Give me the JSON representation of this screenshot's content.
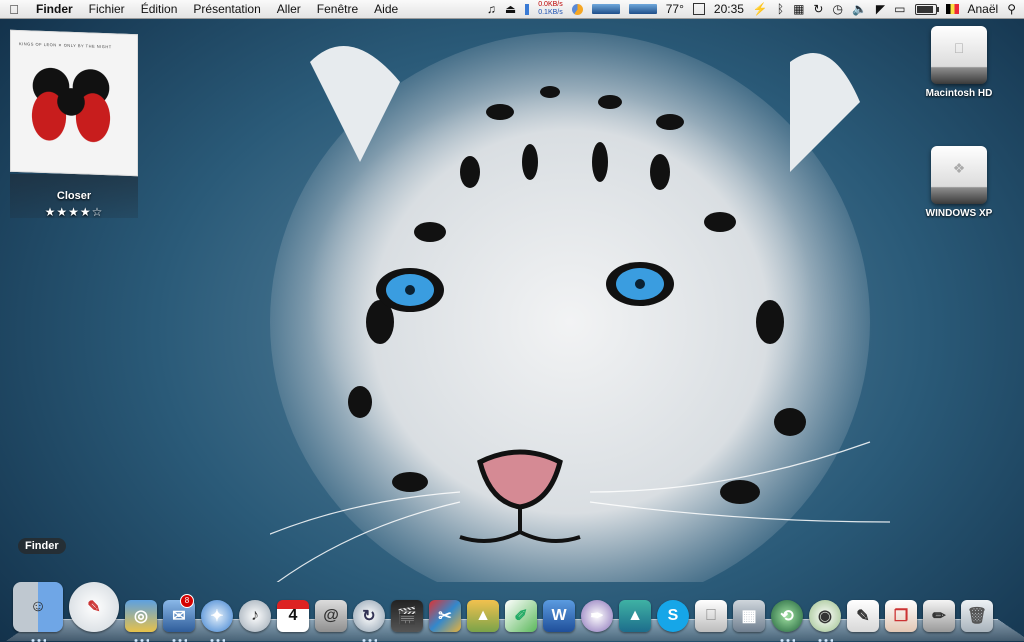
{
  "menubar": {
    "apple_icon": "apple-icon",
    "app_name": "Finder",
    "menus": [
      "Fichier",
      "Édition",
      "Présentation",
      "Aller",
      "Fenêtre",
      "Aide"
    ],
    "status": {
      "net_down": "0.0KB/s",
      "net_up": "0.1KB/s",
      "temperature": "77°",
      "clock": "20:35",
      "user": "Anaël"
    }
  },
  "desktop": {
    "album": {
      "title": "Closer",
      "stars": "★★★★☆",
      "rating": 4,
      "cover_text": "KINGS OF LEON  ✕  ONLY BY THE NIGHT"
    },
    "drives": [
      {
        "label": "Macintosh HD"
      },
      {
        "label": "WINDOWS XP"
      }
    ]
  },
  "dock": {
    "tooltip": "Finder",
    "calendar_day": "4",
    "mail_badge": "8",
    "items": [
      "finder-icon",
      "dashboard-icon",
      "iweb-icon",
      "mail-icon",
      "safari-icon",
      "itunes-icon",
      "ical-icon",
      "address-book-icon",
      "isync-icon",
      "final-cut-icon",
      "photo-booth-icon",
      "iphoto-icon",
      "feather-icon",
      "word-icon",
      "pen-icon",
      "vlc-icon",
      "skype-icon",
      "disk-utility-icon",
      "system-prefs-icon",
      "time-machine-icon",
      "preview-icon",
      "textedit-icon",
      "clipboard-icon",
      "pages-icon",
      "trash-icon"
    ]
  },
  "colors": {
    "menubar_bg": "#eeeeee",
    "desktop_blue": "#2a5a78",
    "leopard_fur": "#e6eaee",
    "eye_blue": "#3a9de0"
  }
}
